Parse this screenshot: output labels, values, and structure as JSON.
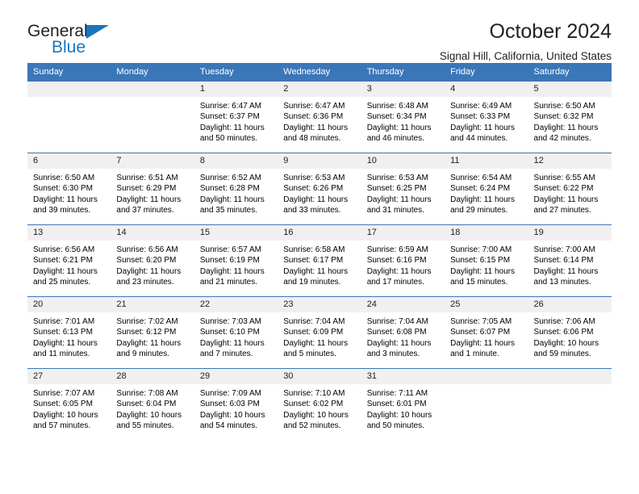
{
  "brand": {
    "name_top": "General",
    "name_bottom": "Blue",
    "triangle_color": "#1b75bb"
  },
  "header": {
    "title": "October 2024",
    "subtitle": "Signal Hill, California, United States"
  },
  "theme": {
    "header_bg": "#3a77b8",
    "daynum_bg": "#f0f0f0",
    "grid_line": "#3a77b8"
  },
  "calendar": {
    "weekday_headers": [
      "Sunday",
      "Monday",
      "Tuesday",
      "Wednesday",
      "Thursday",
      "Friday",
      "Saturday"
    ],
    "weeks": [
      [
        {
          "day": "",
          "lines": []
        },
        {
          "day": "",
          "lines": []
        },
        {
          "day": "1",
          "lines": [
            "Sunrise: 6:47 AM",
            "Sunset: 6:37 PM",
            "Daylight: 11 hours",
            "and 50 minutes."
          ]
        },
        {
          "day": "2",
          "lines": [
            "Sunrise: 6:47 AM",
            "Sunset: 6:36 PM",
            "Daylight: 11 hours",
            "and 48 minutes."
          ]
        },
        {
          "day": "3",
          "lines": [
            "Sunrise: 6:48 AM",
            "Sunset: 6:34 PM",
            "Daylight: 11 hours",
            "and 46 minutes."
          ]
        },
        {
          "day": "4",
          "lines": [
            "Sunrise: 6:49 AM",
            "Sunset: 6:33 PM",
            "Daylight: 11 hours",
            "and 44 minutes."
          ]
        },
        {
          "day": "5",
          "lines": [
            "Sunrise: 6:50 AM",
            "Sunset: 6:32 PM",
            "Daylight: 11 hours",
            "and 42 minutes."
          ]
        }
      ],
      [
        {
          "day": "6",
          "lines": [
            "Sunrise: 6:50 AM",
            "Sunset: 6:30 PM",
            "Daylight: 11 hours",
            "and 39 minutes."
          ]
        },
        {
          "day": "7",
          "lines": [
            "Sunrise: 6:51 AM",
            "Sunset: 6:29 PM",
            "Daylight: 11 hours",
            "and 37 minutes."
          ]
        },
        {
          "day": "8",
          "lines": [
            "Sunrise: 6:52 AM",
            "Sunset: 6:28 PM",
            "Daylight: 11 hours",
            "and 35 minutes."
          ]
        },
        {
          "day": "9",
          "lines": [
            "Sunrise: 6:53 AM",
            "Sunset: 6:26 PM",
            "Daylight: 11 hours",
            "and 33 minutes."
          ]
        },
        {
          "day": "10",
          "lines": [
            "Sunrise: 6:53 AM",
            "Sunset: 6:25 PM",
            "Daylight: 11 hours",
            "and 31 minutes."
          ]
        },
        {
          "day": "11",
          "lines": [
            "Sunrise: 6:54 AM",
            "Sunset: 6:24 PM",
            "Daylight: 11 hours",
            "and 29 minutes."
          ]
        },
        {
          "day": "12",
          "lines": [
            "Sunrise: 6:55 AM",
            "Sunset: 6:22 PM",
            "Daylight: 11 hours",
            "and 27 minutes."
          ]
        }
      ],
      [
        {
          "day": "13",
          "lines": [
            "Sunrise: 6:56 AM",
            "Sunset: 6:21 PM",
            "Daylight: 11 hours",
            "and 25 minutes."
          ]
        },
        {
          "day": "14",
          "lines": [
            "Sunrise: 6:56 AM",
            "Sunset: 6:20 PM",
            "Daylight: 11 hours",
            "and 23 minutes."
          ]
        },
        {
          "day": "15",
          "lines": [
            "Sunrise: 6:57 AM",
            "Sunset: 6:19 PM",
            "Daylight: 11 hours",
            "and 21 minutes."
          ]
        },
        {
          "day": "16",
          "lines": [
            "Sunrise: 6:58 AM",
            "Sunset: 6:17 PM",
            "Daylight: 11 hours",
            "and 19 minutes."
          ]
        },
        {
          "day": "17",
          "lines": [
            "Sunrise: 6:59 AM",
            "Sunset: 6:16 PM",
            "Daylight: 11 hours",
            "and 17 minutes."
          ]
        },
        {
          "day": "18",
          "lines": [
            "Sunrise: 7:00 AM",
            "Sunset: 6:15 PM",
            "Daylight: 11 hours",
            "and 15 minutes."
          ]
        },
        {
          "day": "19",
          "lines": [
            "Sunrise: 7:00 AM",
            "Sunset: 6:14 PM",
            "Daylight: 11 hours",
            "and 13 minutes."
          ]
        }
      ],
      [
        {
          "day": "20",
          "lines": [
            "Sunrise: 7:01 AM",
            "Sunset: 6:13 PM",
            "Daylight: 11 hours",
            "and 11 minutes."
          ]
        },
        {
          "day": "21",
          "lines": [
            "Sunrise: 7:02 AM",
            "Sunset: 6:12 PM",
            "Daylight: 11 hours",
            "and 9 minutes."
          ]
        },
        {
          "day": "22",
          "lines": [
            "Sunrise: 7:03 AM",
            "Sunset: 6:10 PM",
            "Daylight: 11 hours",
            "and 7 minutes."
          ]
        },
        {
          "day": "23",
          "lines": [
            "Sunrise: 7:04 AM",
            "Sunset: 6:09 PM",
            "Daylight: 11 hours",
            "and 5 minutes."
          ]
        },
        {
          "day": "24",
          "lines": [
            "Sunrise: 7:04 AM",
            "Sunset: 6:08 PM",
            "Daylight: 11 hours",
            "and 3 minutes."
          ]
        },
        {
          "day": "25",
          "lines": [
            "Sunrise: 7:05 AM",
            "Sunset: 6:07 PM",
            "Daylight: 11 hours",
            "and 1 minute."
          ]
        },
        {
          "day": "26",
          "lines": [
            "Sunrise: 7:06 AM",
            "Sunset: 6:06 PM",
            "Daylight: 10 hours",
            "and 59 minutes."
          ]
        }
      ],
      [
        {
          "day": "27",
          "lines": [
            "Sunrise: 7:07 AM",
            "Sunset: 6:05 PM",
            "Daylight: 10 hours",
            "and 57 minutes."
          ]
        },
        {
          "day": "28",
          "lines": [
            "Sunrise: 7:08 AM",
            "Sunset: 6:04 PM",
            "Daylight: 10 hours",
            "and 55 minutes."
          ]
        },
        {
          "day": "29",
          "lines": [
            "Sunrise: 7:09 AM",
            "Sunset: 6:03 PM",
            "Daylight: 10 hours",
            "and 54 minutes."
          ]
        },
        {
          "day": "30",
          "lines": [
            "Sunrise: 7:10 AM",
            "Sunset: 6:02 PM",
            "Daylight: 10 hours",
            "and 52 minutes."
          ]
        },
        {
          "day": "31",
          "lines": [
            "Sunrise: 7:11 AM",
            "Sunset: 6:01 PM",
            "Daylight: 10 hours",
            "and 50 minutes."
          ]
        },
        {
          "day": "",
          "lines": []
        },
        {
          "day": "",
          "lines": []
        }
      ]
    ]
  }
}
